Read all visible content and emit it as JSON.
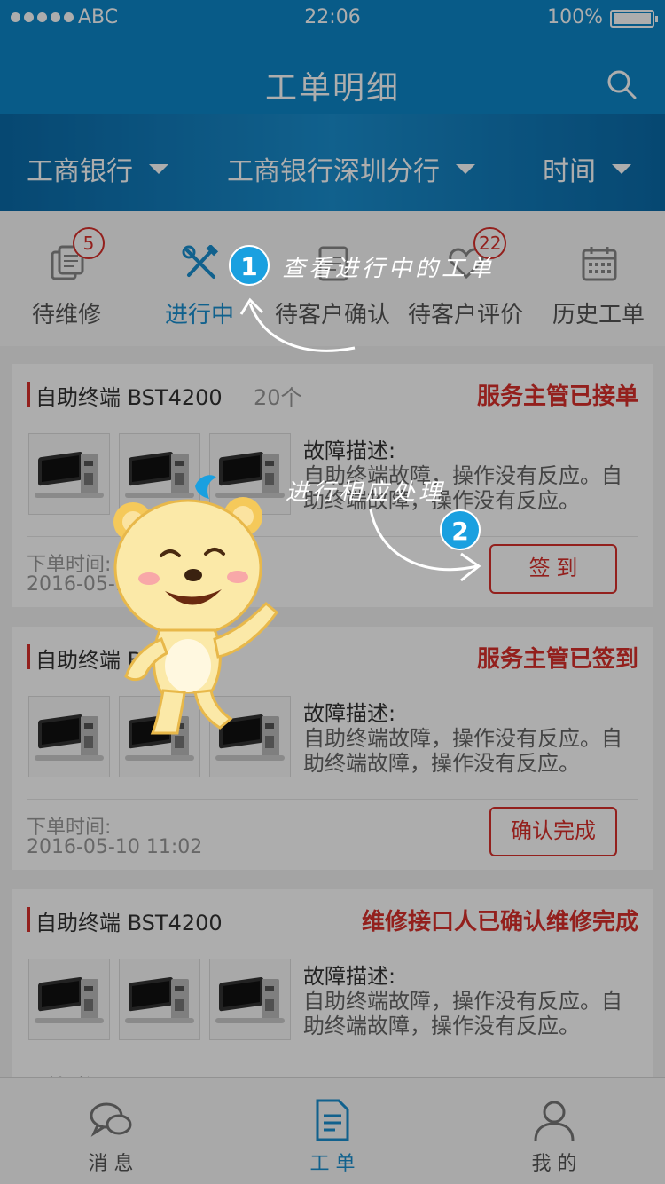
{
  "status_bar": {
    "carrier": "ABC",
    "time": "22:06",
    "battery": "100%"
  },
  "header": {
    "title": "工单明细"
  },
  "filters": [
    {
      "label": "工商银行"
    },
    {
      "label": "工商银行深圳分行"
    },
    {
      "label": "时间"
    }
  ],
  "tabs": [
    {
      "label": "待维修",
      "badge": "5",
      "icon": "document-stack-icon"
    },
    {
      "label": "进行中",
      "badge": "",
      "icon": "tools-icon"
    },
    {
      "label": "待客户确认",
      "badge": "",
      "icon": "document-icon"
    },
    {
      "label": "待客户评价",
      "badge": "22",
      "icon": "heart-icon"
    },
    {
      "label": "历史工单",
      "badge": "",
      "icon": "calendar-icon"
    }
  ],
  "orders": [
    {
      "device": "自助终端 BST4200",
      "count": "20个",
      "status": "服务主管已接单",
      "fault_title": "故障描述:",
      "fault_desc": "自助终端故障，操作没有反应。自助终端故障，操作没有反应。",
      "time_label": "下单时间:",
      "time_value": "2016-05-10  11:02",
      "action": "签  到"
    },
    {
      "device": "自助终端 BST4200",
      "count": "",
      "status": "服务主管已签到",
      "fault_title": "故障描述:",
      "fault_desc": "自助终端故障，操作没有反应。自助终端故障，操作没有反应。",
      "time_label": "下单时间:",
      "time_value": "2016-05-10  11:02",
      "action": "确认完成"
    },
    {
      "device": "自助终端 BST4200",
      "count": "",
      "status": "维修接口人已确认维修完成",
      "fault_title": "故障描述:",
      "fault_desc": "自助终端故障，操作没有反应。自助终端故障，操作没有反应。",
      "time_label": "下单时间:",
      "time_value": "",
      "action": ""
    }
  ],
  "bottom_nav": [
    {
      "label": "消 息",
      "icon": "chat-icon"
    },
    {
      "label": "工 单",
      "icon": "document-icon"
    },
    {
      "label": "我 的",
      "icon": "user-icon"
    }
  ],
  "tour": {
    "step1_number": "1",
    "step1_text": "查看进行中的工单",
    "step2_number": "2",
    "step2_text": "进行相应处理"
  },
  "colors": {
    "header": "#0d86c9",
    "accent": "#d9302b",
    "active": "#1a8fd0",
    "step": "#1aa0e0"
  }
}
